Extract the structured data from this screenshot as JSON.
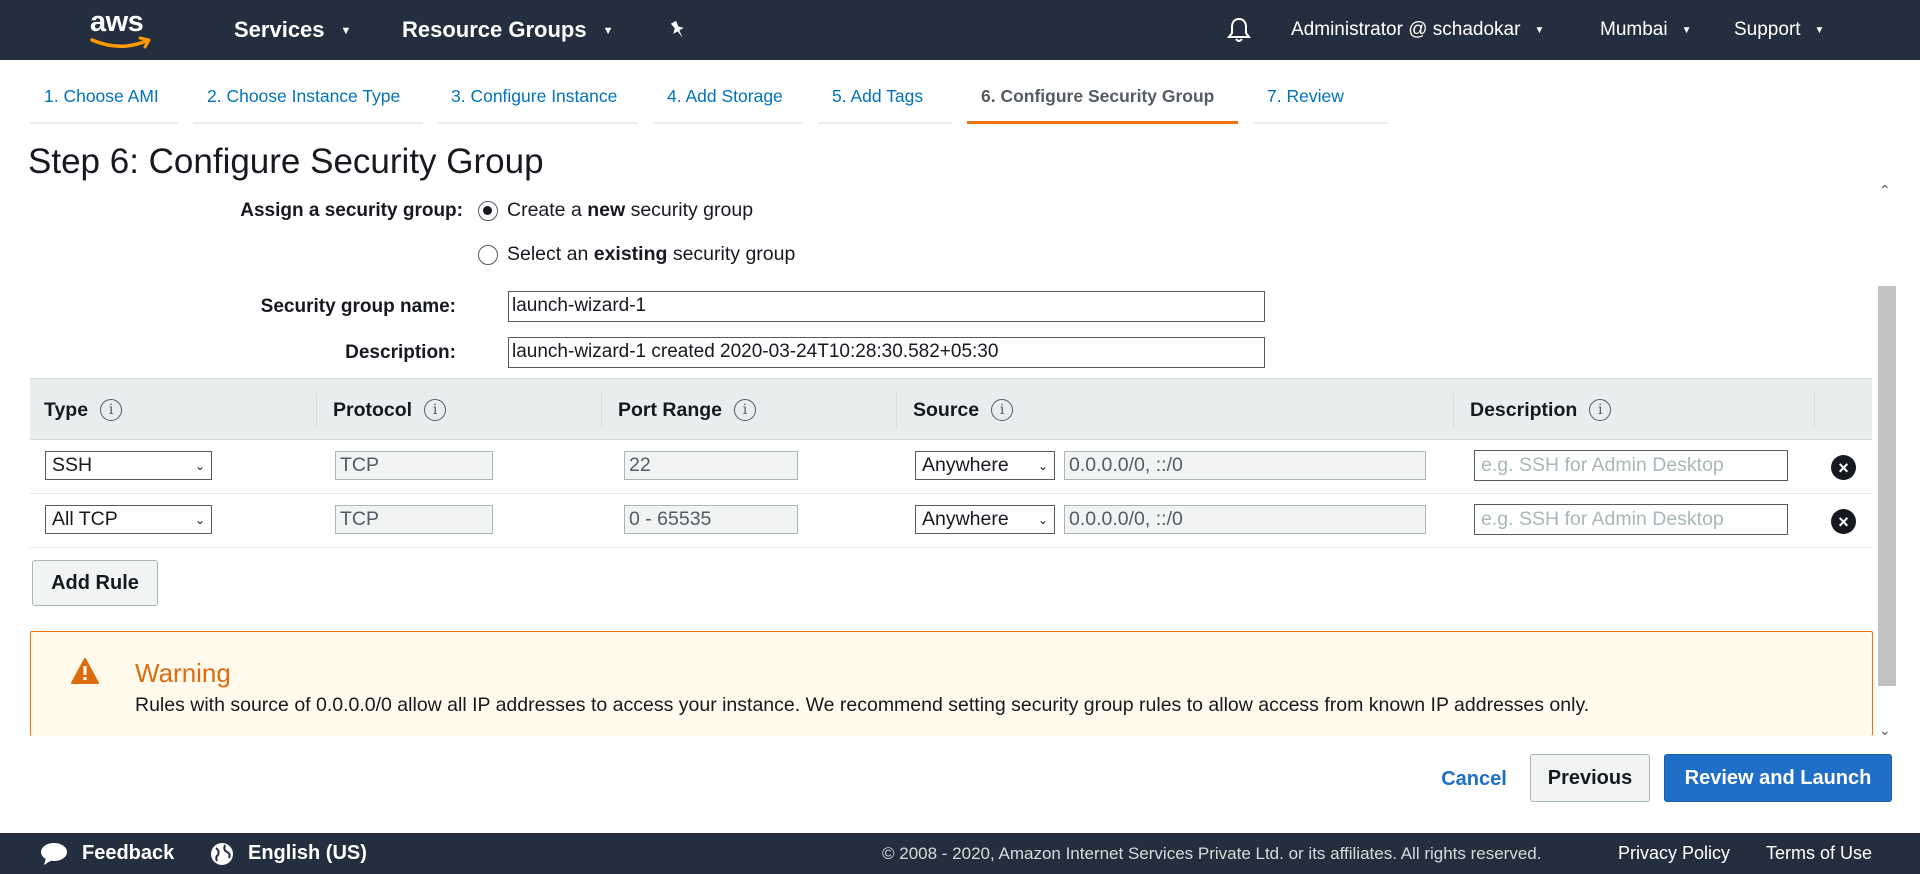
{
  "topnav": {
    "logo_text": "aws",
    "services": "Services",
    "resource_groups": "Resource Groups",
    "user": "Administrator @ schadokar",
    "region": "Mumbai",
    "support": "Support"
  },
  "wizard": {
    "tabs": [
      {
        "label": "1. Choose AMI"
      },
      {
        "label": "2. Choose Instance Type"
      },
      {
        "label": "3. Configure Instance"
      },
      {
        "label": "4. Add Storage"
      },
      {
        "label": "5. Add Tags"
      },
      {
        "label": "6. Configure Security Group"
      },
      {
        "label": "7. Review"
      }
    ]
  },
  "page": {
    "title": "Step 6: Configure Security Group"
  },
  "form": {
    "assign_label": "Assign a security group:",
    "option_new_pre": "Create a ",
    "option_new_bold": "new",
    "option_new_post": " security group",
    "option_existing_pre": "Select an ",
    "option_existing_bold": "existing",
    "option_existing_post": " security group",
    "name_label": "Security group name:",
    "name_value": "launch-wizard-1",
    "desc_label": "Description:",
    "desc_value": "launch-wizard-1 created 2020-03-24T10:28:30.582+05:30"
  },
  "table": {
    "headers": [
      "Type",
      "Protocol",
      "Port Range",
      "Source",
      "Description"
    ],
    "rows": [
      {
        "type": "SSH",
        "protocol": "TCP",
        "port": "22",
        "source_sel": "Anywhere",
        "source_val": "0.0.0.0/0, ::/0",
        "desc_placeholder": "e.g. SSH for Admin Desktop"
      },
      {
        "type": "All TCP",
        "protocol": "TCP",
        "port": "0 - 65535",
        "source_sel": "Anywhere",
        "source_val": "0.0.0.0/0, ::/0",
        "desc_placeholder": "e.g. SSH for Admin Desktop"
      }
    ],
    "add_rule": "Add Rule"
  },
  "warning": {
    "title": "Warning",
    "body": "Rules with source of 0.0.0.0/0 allow all IP addresses to access your instance. We recommend setting security group rules to allow access from known IP addresses only."
  },
  "actions": {
    "cancel": "Cancel",
    "previous": "Previous",
    "review_launch": "Review and Launch"
  },
  "footer": {
    "feedback": "Feedback",
    "language": "English (US)",
    "copyright": "© 2008 - 2020, Amazon Internet Services Private Ltd. or its affiliates. All rights reserved.",
    "privacy": "Privacy Policy",
    "terms": "Terms of Use"
  },
  "colors": {
    "nav_bg": "#232f3e",
    "link": "#0073bb",
    "accent_orange": "#ec7211",
    "primary_blue": "#1f6fc7",
    "warning_bg": "#fffaeb"
  }
}
